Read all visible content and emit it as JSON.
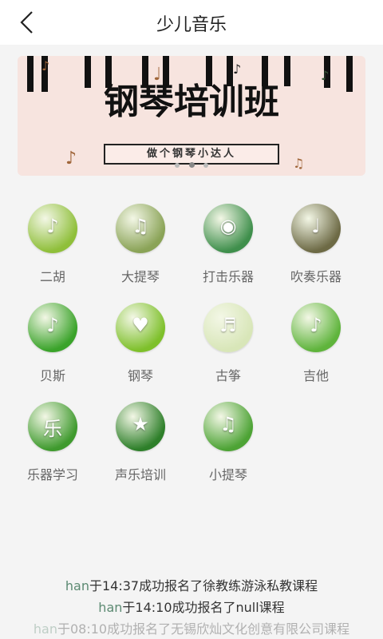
{
  "header": {
    "title": "少儿音乐"
  },
  "banner": {
    "title": "钢琴培训班",
    "subtitle": "做个钢琴小达人",
    "dots_count": 3,
    "active_dot": 1
  },
  "categories": [
    {
      "label": "二胡",
      "icon": "erhu-icon",
      "color": "#8fbf3a",
      "glyph": "♪"
    },
    {
      "label": "大提琴",
      "icon": "cello-icon",
      "color": "#8aa357",
      "glyph": "♫"
    },
    {
      "label": "打击乐器",
      "icon": "drum-icon",
      "color": "#3f8f4c",
      "glyph": "◉"
    },
    {
      "label": "吹奏乐器",
      "icon": "wind-instrument-icon",
      "color": "#6d6a45",
      "glyph": "♩"
    },
    {
      "label": "贝斯",
      "icon": "bass-guitar-icon",
      "color": "#3aa32a",
      "glyph": "♪"
    },
    {
      "label": "钢琴",
      "icon": "piano-icon",
      "color": "#7ec02b",
      "glyph": "♥"
    },
    {
      "label": "古筝",
      "icon": "guzheng-icon",
      "color": "#d8e6b8",
      "glyph": "♬"
    },
    {
      "label": "吉他",
      "icon": "guitar-icon",
      "color": "#5fb43c",
      "glyph": "♪"
    },
    {
      "label": "乐器学习",
      "icon": "instrument-learning-icon",
      "color": "#3f9a2e",
      "glyph": "乐"
    },
    {
      "label": "声乐培训",
      "icon": "vocal-training-icon",
      "color": "#2e7f2a",
      "glyph": "★"
    },
    {
      "label": "小提琴",
      "icon": "violin-icon",
      "color": "#4da335",
      "glyph": "♫"
    }
  ],
  "ticker": [
    {
      "name": "han",
      "text": "于14:37成功报名了徐教练游泳私教课程",
      "opacity": 1
    },
    {
      "name": "han",
      "text": "于14:10成功报名了null课程",
      "opacity": 1
    },
    {
      "name": "han",
      "text": "于08:10成功报名了无锡欣灿文化创意有限公司课程",
      "opacity": 0.35
    }
  ]
}
